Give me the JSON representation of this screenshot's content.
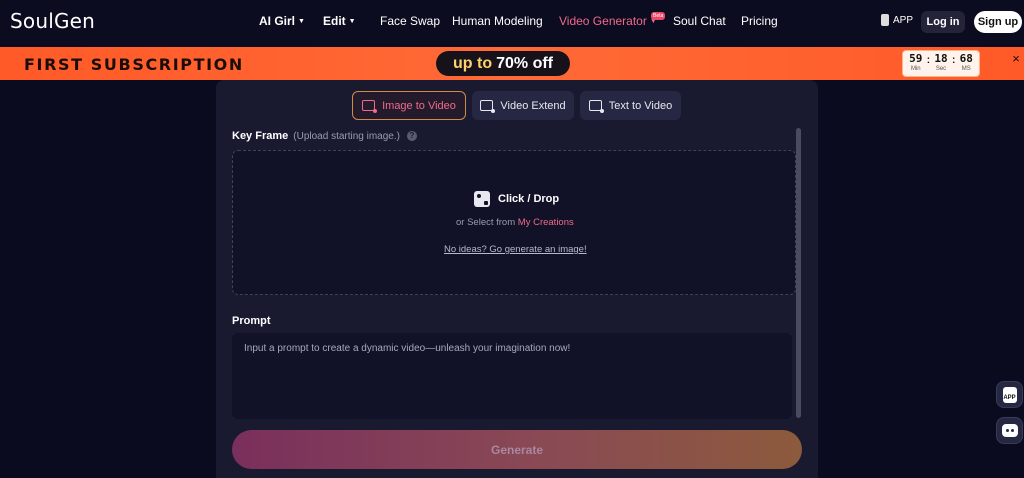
{
  "header": {
    "logo": "SoulGen",
    "nav": [
      {
        "label": "AI Girl",
        "dropdown": true
      },
      {
        "label": "Edit",
        "dropdown": true
      },
      {
        "label": "Face Swap"
      },
      {
        "label": "Human Modeling"
      },
      {
        "label": "Video Generator",
        "dropdown": true,
        "badge": "Beta"
      },
      {
        "label": "Soul Chat"
      },
      {
        "label": "Pricing"
      }
    ],
    "app_label": "APP",
    "login_label": "Log in",
    "signup_label": "Sign up"
  },
  "promo": {
    "left_text": "FIRST SUBSCRIPTION",
    "pill_up": "up to",
    "pill_pct": "70% off",
    "timer": {
      "min": "59",
      "sec": "18",
      "ms": "68",
      "min_label": "Min",
      "sec_label": "Sec",
      "ms_label": "MS"
    },
    "close": "×"
  },
  "tabs": [
    {
      "label": "Image to Video",
      "active": true,
      "icon": "image-video-icon"
    },
    {
      "label": "Video Extend",
      "active": false,
      "icon": "video-extend-icon"
    },
    {
      "label": "Text to Video",
      "active": false,
      "icon": "text-video-icon"
    }
  ],
  "key_frame": {
    "label": "Key Frame",
    "hint": "(Upload starting image.)",
    "help": "?",
    "drop_title": "Click / Drop",
    "select_prefix": "or Select from ",
    "select_link": "My Creations",
    "ideas_link": "No ideas? Go generate an image!"
  },
  "prompt": {
    "label": "Prompt",
    "placeholder": "Input a prompt to create a dynamic video—unleash your imagination now!"
  },
  "generate_label": "Generate",
  "side": {
    "app_label": "APP"
  },
  "colors": {
    "background": "#0b0b1f",
    "panel": "#191a30",
    "accent": "#f06a8a",
    "promo": "#ff5a28"
  }
}
